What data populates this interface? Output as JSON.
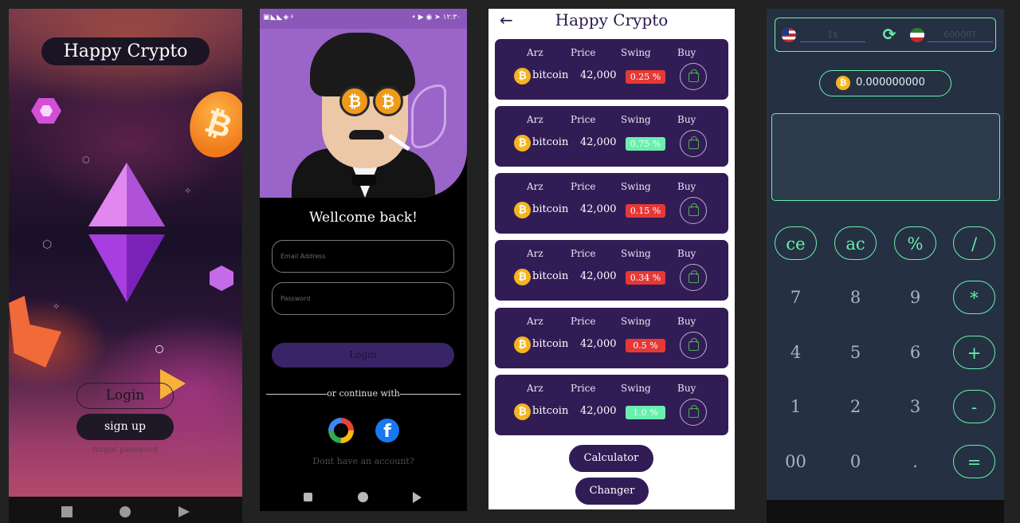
{
  "splash": {
    "title": "Happy Crypto",
    "login_label": "Login",
    "signup_label": "sign up",
    "forgot_label": "forgot password"
  },
  "login_screen": {
    "status_time": "۱۲:۳۰",
    "welcome": "Wellcome back!",
    "email_placeholder": "Email Address",
    "password_placeholder": "Password",
    "login_label": "Login",
    "or_continue": "or continue with",
    "no_account": "Dont have an account?"
  },
  "market": {
    "title": "Happy Crypto",
    "headers": {
      "arz": "Arz",
      "price": "Price",
      "swing": "Swing",
      "buy": "Buy"
    },
    "rows": [
      {
        "name": "bitcoin",
        "price": "42,000",
        "swing": "0.25 %",
        "dir": "down"
      },
      {
        "name": "bitcoin",
        "price": "42,000",
        "swing": "0.75 %",
        "dir": "up"
      },
      {
        "name": "bitcoin",
        "price": "42,000",
        "swing": "0.15 %",
        "dir": "down"
      },
      {
        "name": "bitcoin",
        "price": "42,000",
        "swing": "0.34 %",
        "dir": "down"
      },
      {
        "name": "bitcoin",
        "price": "42,000",
        "swing": "0.5 %",
        "dir": "down"
      },
      {
        "name": "bitcoin",
        "price": "42,000",
        "swing": "1.0 %",
        "dir": "up"
      }
    ],
    "calculator_label": "Calculator",
    "changer_label": "Changer"
  },
  "calculator": {
    "usd_placeholder": "1$",
    "irr_placeholder": "60000T",
    "result": "0.000000000",
    "keys": [
      "ce",
      "ac",
      "%",
      "/",
      "7",
      "8",
      "9",
      "*",
      "4",
      "5",
      "6",
      "+",
      "1",
      "2",
      "3",
      "-",
      "00",
      "0",
      ".",
      "="
    ]
  },
  "colors": {
    "accent_green": "#69f0ae",
    "purple": "#321c56",
    "down_red": "#e53935",
    "coin_gold": "#f4b51c"
  }
}
